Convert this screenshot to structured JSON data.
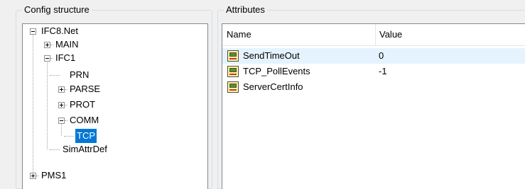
{
  "config_panel": {
    "title": "Config structure"
  },
  "attributes_panel": {
    "title": "Attributes"
  },
  "tree": {
    "nodes": [
      {
        "label": "IFC8.Net",
        "expanded": true
      },
      {
        "label": "MAIN",
        "expanded": false
      },
      {
        "label": "IFC1",
        "expanded": true
      },
      {
        "label": "PRN"
      },
      {
        "label": "PARSE",
        "expanded": false
      },
      {
        "label": "PROT",
        "expanded": false
      },
      {
        "label": "COMM",
        "expanded": true
      },
      {
        "label": "TCP",
        "selected": true
      },
      {
        "label": "SimAttrDef"
      },
      {
        "label": "PMS1",
        "expanded": false
      }
    ]
  },
  "list": {
    "columns": [
      "Name",
      "Value"
    ],
    "rows": [
      {
        "name": "SendTimeOut",
        "value": "0",
        "icon": "attribute-icon"
      },
      {
        "name": "TCP_PollEvents",
        "value": "-1",
        "icon": "attribute-icon"
      },
      {
        "name": "ServerCertInfo",
        "value": "",
        "icon": "attribute-icon"
      }
    ]
  },
  "colors": {
    "selection": "#0078d7",
    "hover_row": "#e5f3ff"
  }
}
